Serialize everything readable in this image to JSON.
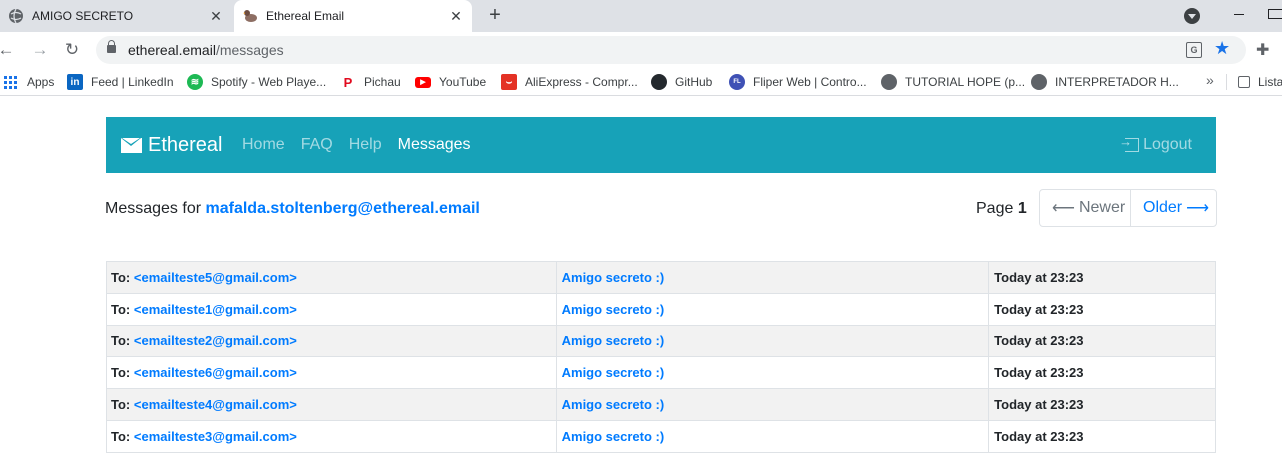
{
  "browser": {
    "tabs": [
      {
        "title": "AMIGO SECRETO",
        "icon": "globe-icon",
        "active": false
      },
      {
        "title": "Ethereal Email",
        "icon": "ethereal-duck-icon",
        "active": true
      }
    ],
    "url_host": "ethereal.email",
    "url_path": "/messages",
    "bookmarks": [
      {
        "label": "Apps",
        "icon": "apps-grid-icon"
      },
      {
        "label": "Feed | LinkedIn",
        "icon": "linkedin-icon",
        "glyph": "in",
        "color": "#0a66c2"
      },
      {
        "label": "Spotify - Web Playe...",
        "icon": "spotify-icon",
        "glyph": "",
        "color": "#1db954"
      },
      {
        "label": "Pichau",
        "icon": "pichau-icon",
        "glyph": "P",
        "color": "#e10a1e"
      },
      {
        "label": "YouTube",
        "icon": "youtube-icon",
        "glyph": "▶",
        "color": "#ff0000"
      },
      {
        "label": "AliExpress - Compr...",
        "icon": "aliexpress-icon",
        "glyph": "⌣",
        "color": "#e43225"
      },
      {
        "label": "GitHub",
        "icon": "github-icon",
        "glyph": "●",
        "color": "#24292e"
      },
      {
        "label": "Fliper Web | Contro...",
        "icon": "fliper-icon",
        "glyph": "FL",
        "color": "#3f51b5"
      },
      {
        "label": "TUTORIAL HOPE (p...",
        "icon": "globe-icon",
        "glyph": "",
        "color": "#5f6368"
      },
      {
        "label": "INTERPRETADOR H...",
        "icon": "globe-icon",
        "glyph": "",
        "color": "#5f6368"
      }
    ],
    "bookmarks_overflow": "»",
    "reading_list": "Lista"
  },
  "navbar": {
    "brand": "Ethereal",
    "links": [
      {
        "label": "Home",
        "current": false
      },
      {
        "label": "FAQ",
        "current": false
      },
      {
        "label": "Help",
        "current": false
      },
      {
        "label": "Messages",
        "current": true
      }
    ],
    "logout": "Logout",
    "bg_color": "#17a2b8"
  },
  "messages_header": {
    "prefix": "Messages for",
    "email": "mafalda.stoltenberg@ethereal.email",
    "page_label": "Page",
    "page_number": "1",
    "newer": "Newer",
    "older": "Older"
  },
  "messages": [
    {
      "to_label": "To:",
      "to": "<emailteste5@gmail.com>",
      "subject": "Amigo secreto :)",
      "date": "Today at 23:23"
    },
    {
      "to_label": "To:",
      "to": "<emailteste1@gmail.com>",
      "subject": "Amigo secreto :)",
      "date": "Today at 23:23"
    },
    {
      "to_label": "To:",
      "to": "<emailteste2@gmail.com>",
      "subject": "Amigo secreto :)",
      "date": "Today at 23:23"
    },
    {
      "to_label": "To:",
      "to": "<emailteste6@gmail.com>",
      "subject": "Amigo secreto :)",
      "date": "Today at 23:23"
    },
    {
      "to_label": "To:",
      "to": "<emailteste4@gmail.com>",
      "subject": "Amigo secreto :)",
      "date": "Today at 23:23"
    },
    {
      "to_label": "To:",
      "to": "<emailteste3@gmail.com>",
      "subject": "Amigo secreto :)",
      "date": "Today at 23:23"
    }
  ]
}
